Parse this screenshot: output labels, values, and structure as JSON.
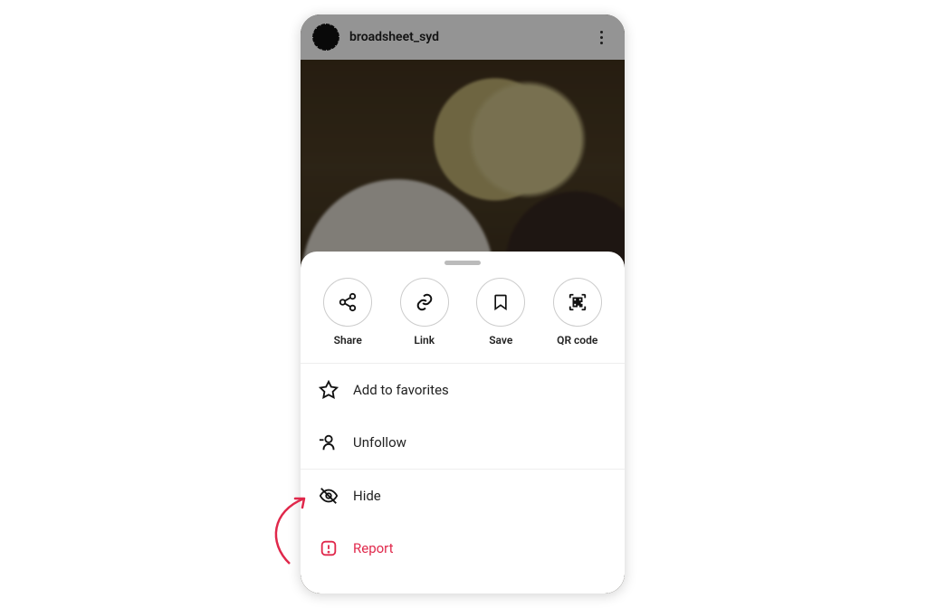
{
  "post": {
    "username": "broadsheet_syd"
  },
  "sheet": {
    "actions": {
      "share": "Share",
      "link": "Link",
      "save": "Save",
      "qrcode": "QR code"
    },
    "items": {
      "favorites": "Add to favorites",
      "unfollow": "Unfollow",
      "hide": "Hide",
      "report": "Report"
    }
  },
  "colors": {
    "danger": "#e0284b"
  }
}
